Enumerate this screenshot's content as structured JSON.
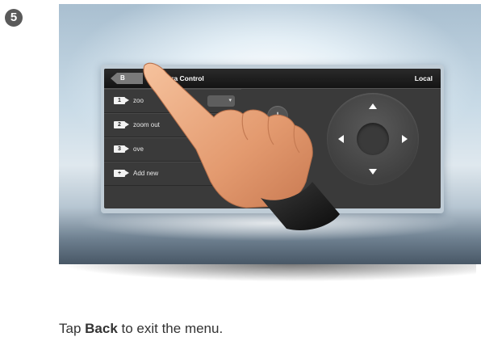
{
  "step": {
    "number": "5"
  },
  "screen": {
    "back_label": "B",
    "title": "Camera Control",
    "status": "Local",
    "presets": [
      {
        "id": "1",
        "label": "zoo",
        "has_dropdown": true
      },
      {
        "id": "2",
        "label": "zoom out",
        "has_dropdown": false
      },
      {
        "id": "3",
        "label": "ove",
        "has_dropdown": false
      },
      {
        "id": "+",
        "label": "Add new",
        "has_dropdown": false
      }
    ],
    "zoom_in_label": "+",
    "dpad_directions": [
      "up",
      "down",
      "left",
      "right"
    ]
  },
  "caption": {
    "before": "Tap ",
    "emphasis": "Back",
    "after": " to exit the menu."
  },
  "colors": {
    "panel_bg": "#3a3a3a",
    "titlebar_bg": "#141414",
    "skin": "#e9a37a",
    "sleeve": "#151515"
  },
  "icons": {
    "step_badge": "circled-number",
    "back": "back-arrow-button",
    "camera": "camera-icon",
    "zoom": "magnifier-icon",
    "dpad": "direction-pad"
  }
}
